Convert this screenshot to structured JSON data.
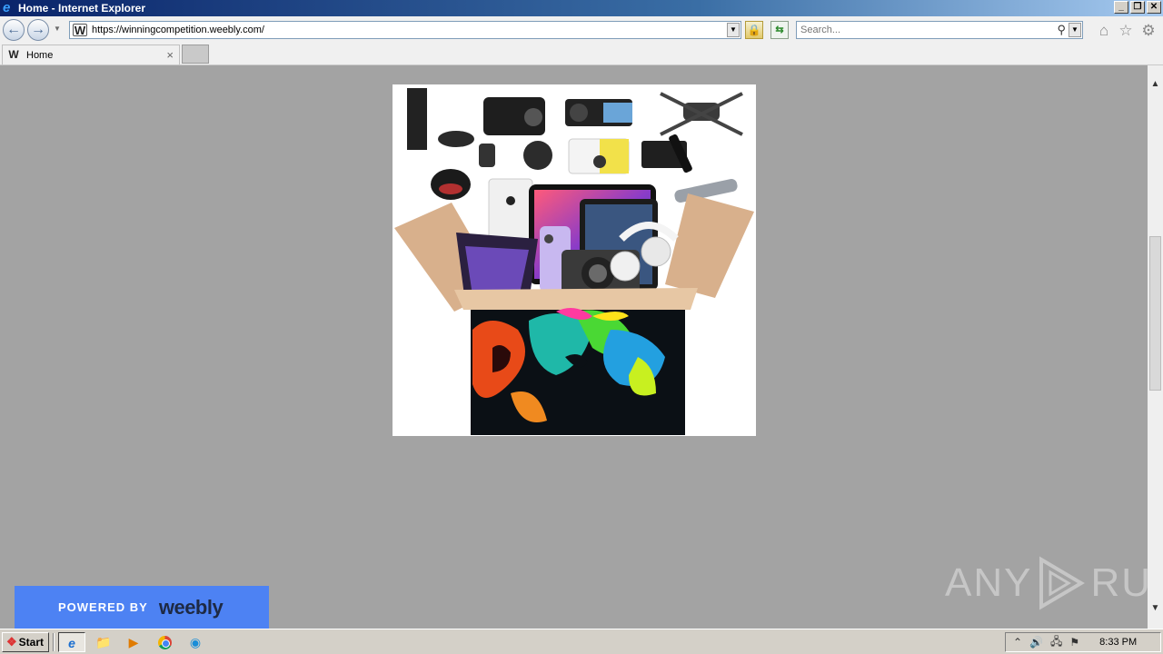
{
  "window": {
    "title": "Home - Internet Explorer",
    "controls": [
      "_",
      "❐",
      "✕"
    ]
  },
  "nav": {
    "url": "https://winningcompetition.weebly.com/",
    "search_placeholder": "Search..."
  },
  "tabs": [
    {
      "label": "Home",
      "close": "×"
    }
  ],
  "page": {
    "badge_prefix": "POWERED BY",
    "badge_brand": "weebly"
  },
  "watermark": {
    "left": "ANY",
    "right": "RUN"
  },
  "taskbar": {
    "start_label": "Start",
    "clock": "8:33 PM"
  }
}
